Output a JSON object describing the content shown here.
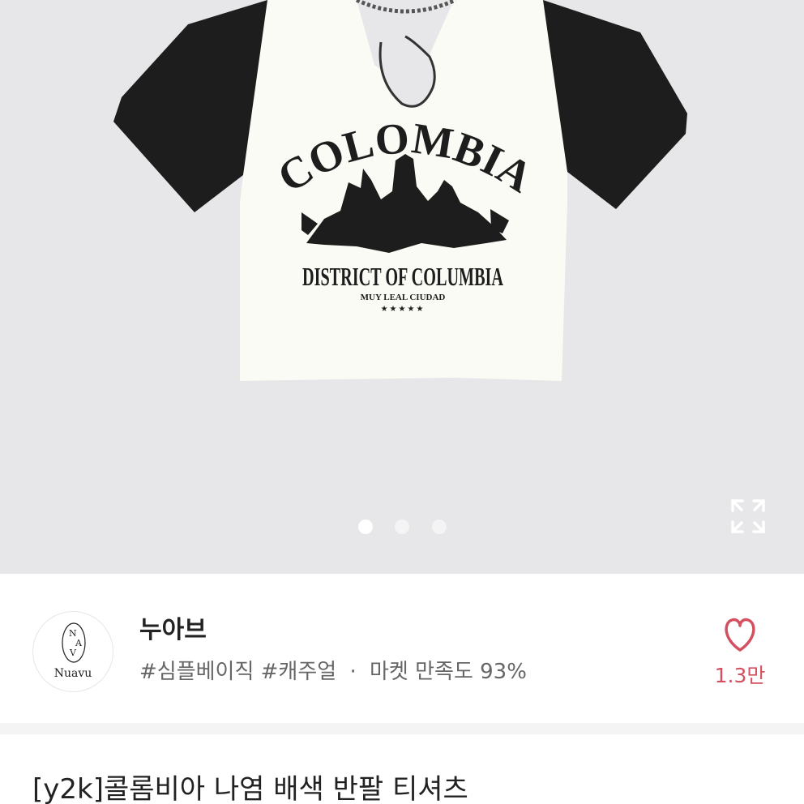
{
  "gallery": {
    "print_title": "COLOMBIA",
    "print_subtitle": "DISTRICT OF COLUMBIA",
    "print_motto": "MUY LEAL CIUDAD",
    "print_stars": "★★★★★",
    "image_count": 3,
    "active_index": 0,
    "icons": {
      "expand": "expand-icon"
    },
    "colors": {
      "background": "#e7e7e9",
      "shirt_body": "#fbfbf6",
      "sleeve": "#1d1d1d"
    }
  },
  "shop": {
    "logo_text": "Nuavu",
    "name": "누아브",
    "tags": "#심플베이직 #캐주얼",
    "separator": "·",
    "satisfaction_label": "마켓 만족도 93%",
    "like_count": "1.3만",
    "icons": {
      "like": "heart-icon"
    },
    "colors": {
      "like": "#d45061"
    }
  },
  "product": {
    "title": "[y2k]콜롬비아 나염 배색 반팔 티셔츠"
  }
}
